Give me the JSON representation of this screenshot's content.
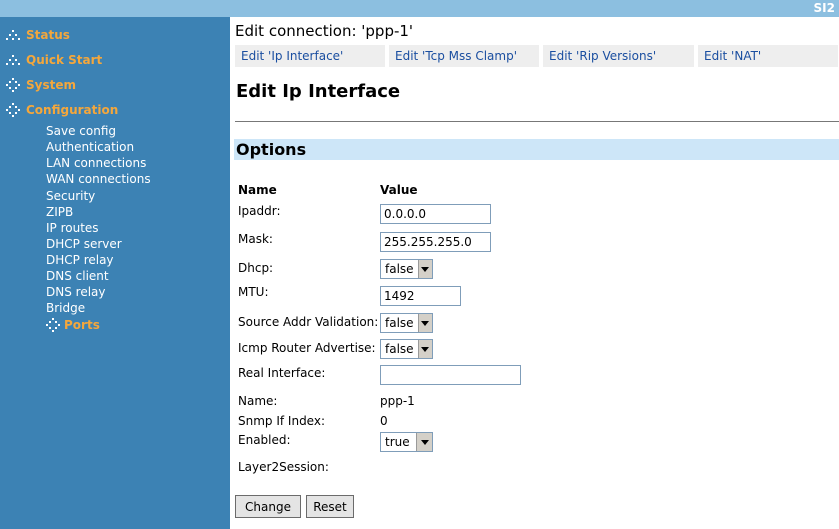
{
  "header": {
    "brand": "SI2"
  },
  "sidebar": {
    "main": [
      "Status",
      "Quick Start",
      "System",
      "Configuration"
    ],
    "sub": [
      "Save config",
      "Authentication",
      "LAN connections",
      "WAN connections",
      "Security",
      "ZIPB",
      "IP routes",
      "DHCP server",
      "DHCP relay",
      "DNS client",
      "DNS relay",
      "Bridge"
    ],
    "active": "Ports"
  },
  "main": {
    "connection_title": "Edit connection: 'ppp-1'",
    "tabs": [
      "Edit 'Ip Interface'",
      "Edit 'Tcp Mss Clamp'",
      "Edit 'Rip Versions'",
      "Edit 'NAT'"
    ],
    "page_title": "Edit Ip Interface",
    "section_title": "Options",
    "col_name": "Name",
    "col_value": "Value"
  },
  "form": {
    "ipaddr": {
      "label": "Ipaddr:",
      "value": "0.0.0.0"
    },
    "mask": {
      "label": "Mask:",
      "value": "255.255.255.0"
    },
    "dhcp": {
      "label": "Dhcp:",
      "value": "false"
    },
    "mtu": {
      "label": "MTU:",
      "value": "1492"
    },
    "source_addr_validation": {
      "label": "Source Addr Validation:",
      "value": "false"
    },
    "icmp_router_advertise": {
      "label": "Icmp Router Advertise:",
      "value": "false"
    },
    "real_interface": {
      "label": "Real Interface:",
      "value": ""
    },
    "name": {
      "label": "Name:",
      "value": "ppp-1"
    },
    "snmp_if_index": {
      "label": "Snmp If Index:",
      "value": "0"
    },
    "enabled": {
      "label": "Enabled:",
      "value": "true"
    },
    "layer2session": {
      "label": "Layer2Session:"
    }
  },
  "buttons": {
    "change": "Change",
    "reset": "Reset"
  },
  "colors": {
    "sidebar": "#3c82b4",
    "accent": "#f4a73c",
    "topbar": "#8cbfe0",
    "section": "#cde6f8"
  }
}
